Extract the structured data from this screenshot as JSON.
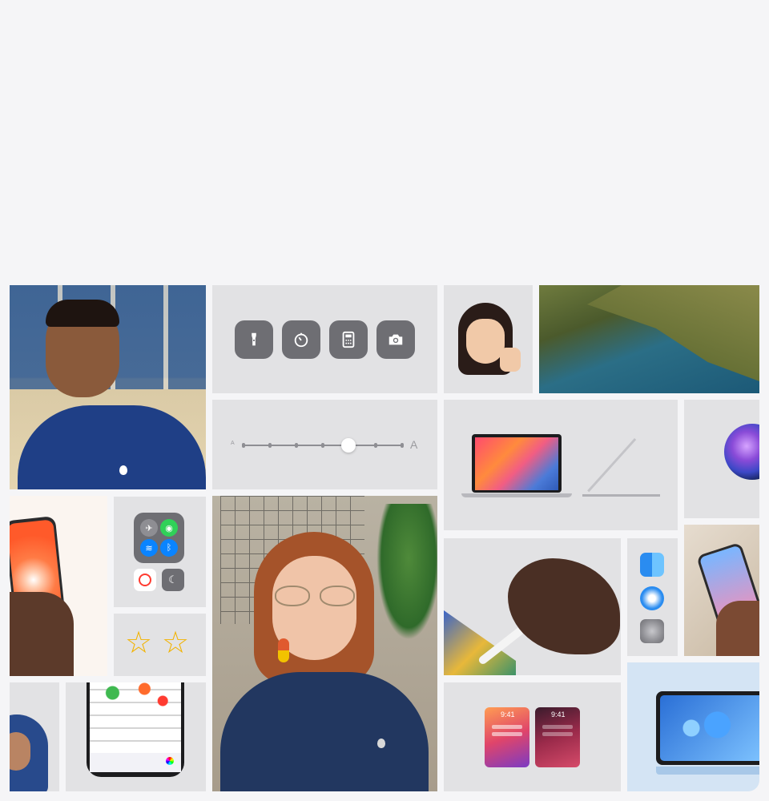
{
  "controls": {
    "flashlight_icon": "flashlight-icon",
    "timer_icon": "timer-icon",
    "calculator_icon": "calculator-icon",
    "camera_icon": "camera-icon"
  },
  "slider": {
    "small_label": "A",
    "large_label": "A",
    "level_percent": 67
  },
  "widgets": {
    "time_left": "9:41",
    "time_right": "9:41"
  },
  "colors": {
    "page_bg": "#f5f5f7",
    "tile_bg": "#e2e2e4",
    "control_gray": "#6e6e73",
    "apple_blue": "#0a84ff",
    "cc_green": "#30d158"
  }
}
